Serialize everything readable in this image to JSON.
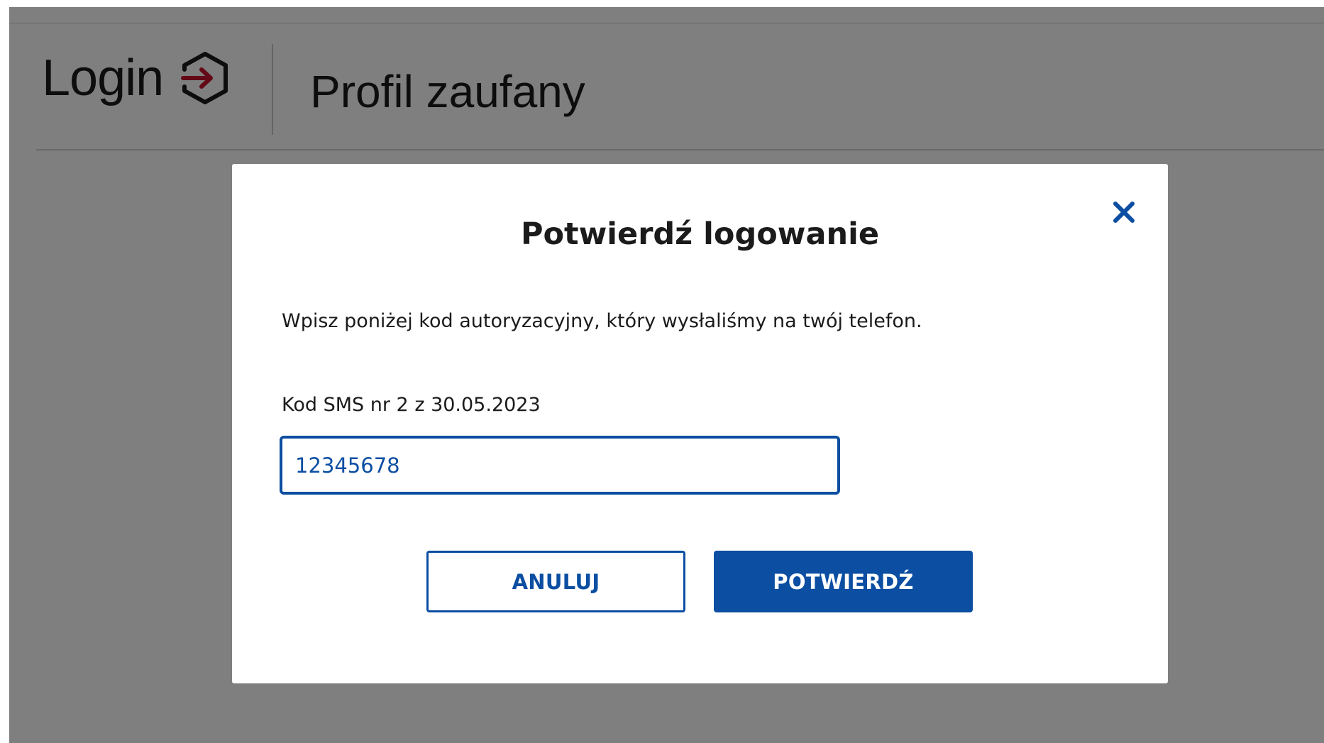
{
  "header": {
    "brand": "Login",
    "brand_icon": "login-arrow-icon",
    "title": "Profil zaufany"
  },
  "modal": {
    "title": "Potwierdź logowanie",
    "description": "Wpisz poniżej kod autoryzacyjny, który wysłaliśmy na twój telefon.",
    "close_icon": "close-icon",
    "field": {
      "label": "Kod SMS nr 2 z 30.05.2023",
      "value": "12345678"
    },
    "buttons": {
      "cancel": "ANULUJ",
      "confirm": "POTWIERDŹ"
    }
  },
  "colors": {
    "accent": "#0b4ea2",
    "icon_arrow": "#c8102e",
    "overlay": "rgba(0,0,0,0.5)"
  }
}
